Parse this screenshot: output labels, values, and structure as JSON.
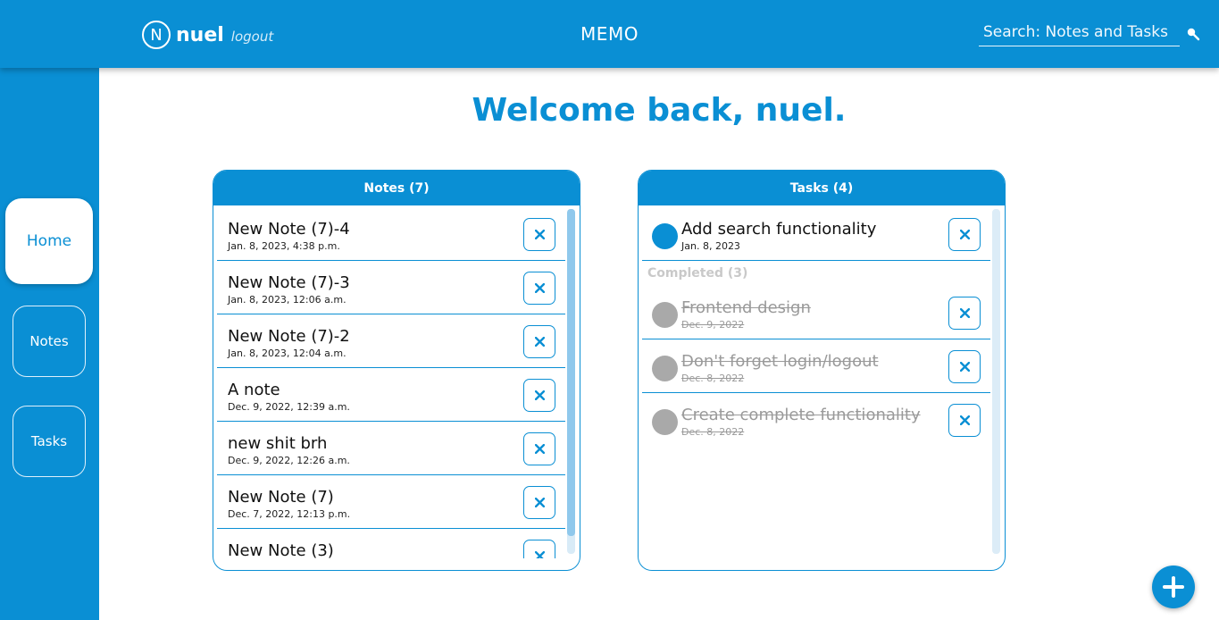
{
  "header": {
    "logo_letter": "N",
    "username": "nuel",
    "logout_label": "logout",
    "title": "MEMO",
    "search_placeholder": "Search: Notes and Tasks"
  },
  "sidebar": {
    "items": [
      {
        "label": "Home",
        "active": true
      },
      {
        "label": "Notes",
        "active": false
      },
      {
        "label": "Tasks",
        "active": false
      }
    ]
  },
  "welcome": "Welcome back, nuel.",
  "notes": {
    "title": "Notes (7)",
    "items": [
      {
        "title": "New Note (7)-4",
        "date": "Jan. 8, 2023, 4:38 p.m."
      },
      {
        "title": "New Note (7)-3",
        "date": "Jan. 8, 2023, 12:06 a.m."
      },
      {
        "title": "New Note (7)-2",
        "date": "Jan. 8, 2023, 12:04 a.m."
      },
      {
        "title": "A note",
        "date": "Dec. 9, 2022, 12:39 a.m."
      },
      {
        "title": "new shit brh",
        "date": "Dec. 9, 2022, 12:26 a.m."
      },
      {
        "title": "New Note (7)",
        "date": "Dec. 7, 2022, 12:13 p.m."
      },
      {
        "title": "New Note (3)",
        "date": ""
      }
    ]
  },
  "tasks": {
    "title": "Tasks (4)",
    "pending": [
      {
        "title": "Add search functionality",
        "date": "Jan. 8, 2023"
      }
    ],
    "completed_label": "Completed (3)",
    "completed": [
      {
        "title": "Frontend design",
        "date": "Dec. 9, 2022"
      },
      {
        "title": "Don't forget login/logout",
        "date": "Dec. 8, 2022"
      },
      {
        "title": "Create complete functionality",
        "date": "Dec. 8, 2022"
      }
    ]
  },
  "colors": {
    "primary": "#0a8fd4",
    "completed_gray": "#a9a9a9",
    "completed_label": "#c9c9c9"
  },
  "icons": {
    "delete": "close-icon",
    "search": "search-icon",
    "add": "plus-icon"
  }
}
